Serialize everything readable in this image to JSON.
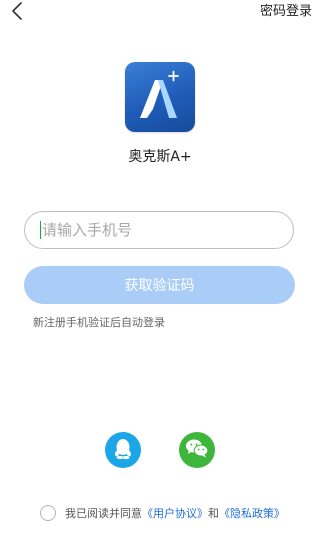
{
  "header": {
    "back_icon": "chevron-left-icon",
    "password_login_label": "密码登录"
  },
  "app": {
    "logo_icon": "app-logo-icon",
    "name": "奥克斯A+"
  },
  "form": {
    "phone_placeholder": "请输入手机号",
    "phone_value": "",
    "get_code_label": "获取验证码",
    "hint": "新注册手机验证后自动登录"
  },
  "social": {
    "qq_icon": "qq-icon",
    "wechat_icon": "wechat-icon"
  },
  "agreement": {
    "prefix": "我已阅读并同意",
    "user_agreement": "《用户协议》",
    "conjunction": "和",
    "privacy_policy": "《隐私政策》"
  },
  "colors": {
    "primary_button_disabled": "#a9cdf7",
    "link": "#1f6fd6",
    "qq": "#1aa6e7",
    "wechat": "#3eb53b",
    "logo_blue": "#1f5cb8"
  }
}
